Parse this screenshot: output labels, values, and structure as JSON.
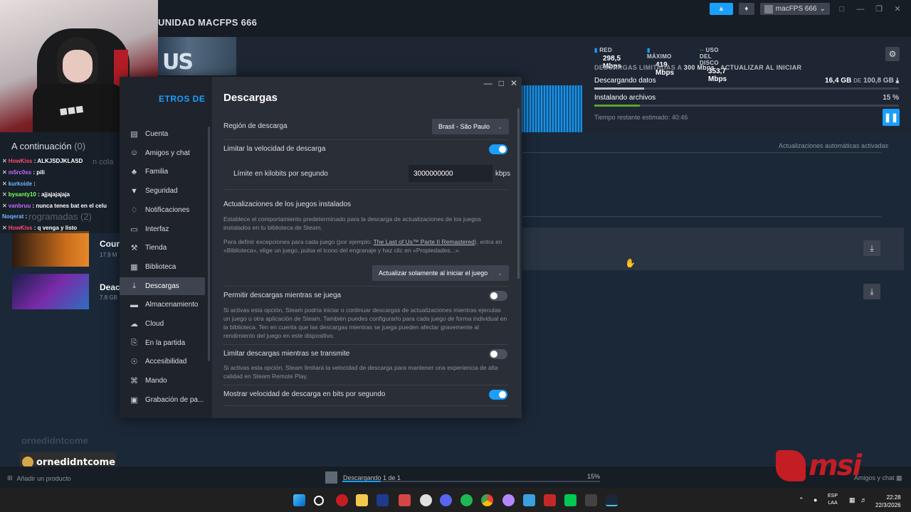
{
  "steam_header": {
    "nav_comunidad": "UNIDAD",
    "nav_user": "MACFPS 666",
    "account_name": "macFPS 666"
  },
  "stats": {
    "red_label": "RED",
    "red_value": "298,5 Mbps",
    "max_label": "MÁXIMO",
    "max_value": "419 Mbps",
    "disk_label": "USO DEL DISCO",
    "disk_value": "353,7 Mbps",
    "limit_text": "DESCARGAS LIMITADAS A",
    "limit_value": "300 Mbps",
    "update_on_start": "ACTUALIZAR AL INICIAR"
  },
  "progress": {
    "downloading_label": "Descargando datos",
    "downloaded": "16,4 GB",
    "of_word": "DE",
    "total": "100,8 GB",
    "download_fraction": 0.163,
    "installing_label": "Instalando archivos",
    "installing_pct": "15 %",
    "installing_fraction": 0.15,
    "time_left": "Tiempo restante estimado: 40:46"
  },
  "queue": {
    "auto_updates": "Actualizaciones automáticas activadas",
    "games": [
      {
        "title": "Cour",
        "size": "17.9 M"
      },
      {
        "title": "Deac",
        "size": "7.8 GB"
      }
    ]
  },
  "stream_overlay": {
    "up_next_title": "A continuación",
    "up_next_count": "(0)",
    "faded_queue": "n cola",
    "faded_scheduled": "rogramadas",
    "faded_scheduled_count": "(2)",
    "chat": [
      {
        "user": "HowKiss",
        "msg": ": ALKJSDJKLASD"
      },
      {
        "user": "m5rc0ss",
        "msg": ": pili"
      },
      {
        "user": "kurkoide",
        "msg": ":"
      },
      {
        "user": "bysanty10",
        "msg": ": ajjajajajaja"
      },
      {
        "user": "vanbruu",
        "msg": ": nunca tenes bat en el celu"
      },
      {
        "user": "Noqerat",
        "msg": ":"
      },
      {
        "user": "HowKiss",
        "msg": ": q venga y listo"
      }
    ],
    "popup_name": "ornedidntcome"
  },
  "settings": {
    "sidebar_head": "ETROS DE",
    "sidebar_items": [
      {
        "label": "Cuenta",
        "icon": "account-icon"
      },
      {
        "label": "Amigos y chat",
        "icon": "friends-icon"
      },
      {
        "label": "Familia",
        "icon": "family-icon"
      },
      {
        "label": "Seguridad",
        "icon": "shield-icon"
      },
      {
        "label": "Notificaciones",
        "icon": "bell-icon"
      },
      {
        "label": "Interfaz",
        "icon": "monitor-icon"
      },
      {
        "label": "Tienda",
        "icon": "cart-icon"
      },
      {
        "label": "Biblioteca",
        "icon": "grid-icon"
      },
      {
        "label": "Descargas",
        "icon": "download-icon"
      },
      {
        "label": "Almacenamiento",
        "icon": "storage-icon"
      },
      {
        "label": "Cloud",
        "icon": "cloud-icon"
      },
      {
        "label": "En la partida",
        "icon": "ingame-icon"
      },
      {
        "label": "Accesibilidad",
        "icon": "accessibility-icon"
      },
      {
        "label": "Mando",
        "icon": "controller-icon"
      },
      {
        "label": "Grabación de pa...",
        "icon": "record-icon"
      }
    ],
    "active_item": "Descargas",
    "title": "Descargas",
    "region_label": "Región de descarga",
    "region_value": "Brasil - São Paulo",
    "limit_speed_label": "Limitar la velocidad de descarga",
    "limit_speed_on": true,
    "kbps_label": "Límite en kilobits por segundo",
    "kbps_value": "3000000000",
    "kbps_unit": "kbps",
    "updates_heading": "Actualizaciones de los juegos instalados",
    "updates_desc1": "Establece el comportamiento predeterminado para la descarga de actualizaciones de los juegos instalados en tu biblioteca de Steam.",
    "updates_desc2_pre": "Para definir excepciones para cada juego (por ejemplo: ",
    "updates_desc2_link": "The Last of Us™ Parte II Remastered",
    "updates_desc2_post": "), entra en «Biblioteca», elige un juego, pulsa el icono del engranaje y haz clic en «Propiedades...».",
    "updates_dropdown": "Actualizar solamente al iniciar el juego",
    "allow_play_label": "Permitir descargas mientras se juega",
    "allow_play_on": false,
    "allow_play_desc": "Si activas esta opción, Steam podría iniciar o continuar descargas de actualizaciones mientras ejecutas un juego u otra aplicación de Steam. También puedes configurarlo para cada juego de forma individual en la biblioteca. Ten en cuenta que las descargas mientras se juega pueden afectar gravemente al rendimiento del juego en este dispositivo.",
    "stream_limit_label": "Limitar descargas mientras se transmite",
    "stream_limit_on": false,
    "stream_limit_desc": "Si activas esta opción, Steam limitará la velocidad de descarga para mantener una experiencia de alta calidad en Steam Remote Play.",
    "bits_label": "Mostrar velocidad de descarga en bits por segundo",
    "bits_on": true
  },
  "bottom": {
    "add_product": "Añadir un producto",
    "downloading": "Descargando 1 de 1",
    "pct": "15%",
    "fraction": 0.15,
    "friends_chat": "Amigos y chat"
  },
  "brand": {
    "msi": "msi"
  },
  "system_tray": {
    "lang1": "ESP",
    "lang2": "LAA",
    "time": "22:28",
    "date": "22/3/2026"
  }
}
